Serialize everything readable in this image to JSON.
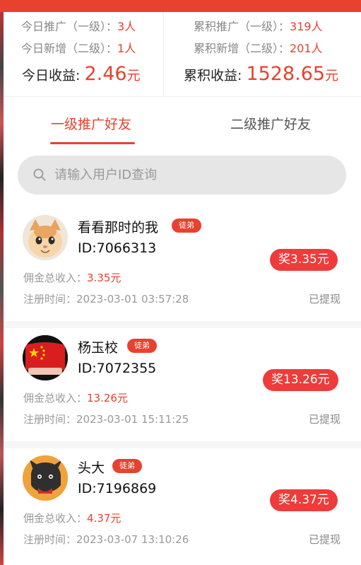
{
  "summary": {
    "today_promote_label": "今日推广（一级）：",
    "today_promote_value": "3人",
    "today_new_label": "今日新增（二级）：",
    "today_new_value": "1人",
    "total_promote_label": "累积推广（一级）：",
    "total_promote_value": "319人",
    "total_new_label": "累积新增（二级）：",
    "total_new_value": "201人",
    "today_income_label": "今日收益:",
    "today_income_amount": "2.46",
    "today_income_unit": "元",
    "total_income_label": "累积收益:",
    "total_income_amount": "1528.65",
    "total_income_unit": "元"
  },
  "tabs": [
    {
      "label": "一级推广好友",
      "active": true
    },
    {
      "label": "二级推广好友",
      "active": false
    }
  ],
  "search": {
    "placeholder": "请输入用户ID查询",
    "icon": "search-icon"
  },
  "friends": [
    {
      "name": "看看那时的我",
      "badge": "徒弟",
      "id_text": "ID:7066313",
      "reward": "奖3.35元",
      "income_label": "佣金总收入：",
      "income_value": "3.35元",
      "reg_label": "注册时间：",
      "reg_time": "2023-03-01 03:57:28",
      "status": "已提现",
      "avatar": "cat-avatar"
    },
    {
      "name": "杨玉校",
      "badge": "徒弟",
      "id_text": "ID:7072355",
      "reward": "奖13.26元",
      "income_label": "佣金总收入：",
      "income_value": "13.26元",
      "reg_label": "注册时间：",
      "reg_time": "2023-03-01 15:11:25",
      "status": "已提现",
      "avatar": "flag-avatar"
    },
    {
      "name": "头大",
      "badge": "徒弟",
      "id_text": "ID:7196869",
      "reward": "奖4.37元",
      "income_label": "佣金总收入：",
      "income_value": "4.37元",
      "reg_label": "注册时间：",
      "reg_time": "2023-03-07 13:10:26",
      "status": "已提现",
      "avatar": "cartoon-avatar"
    }
  ],
  "colors": {
    "accent": "#e8412f",
    "reward_bg": "#ee3b3b",
    "search_bg": "#e6e6e6"
  }
}
